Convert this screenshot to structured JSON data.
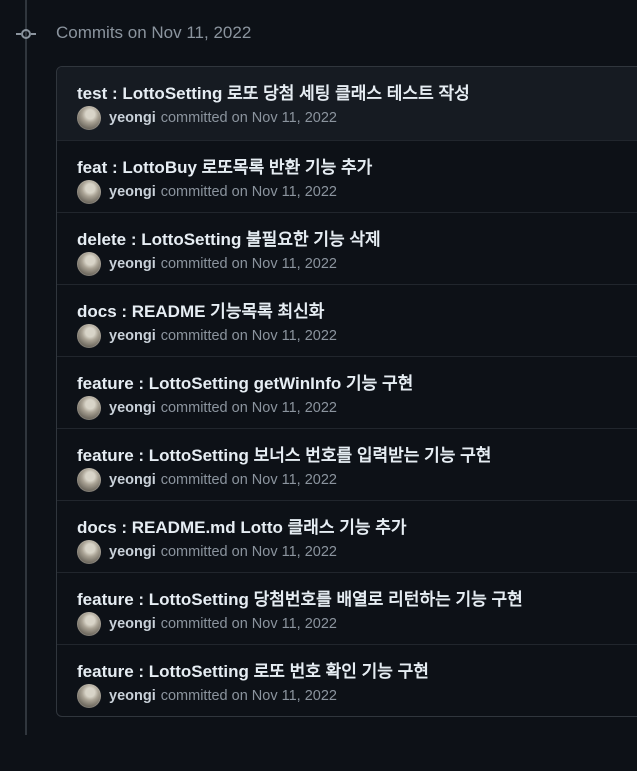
{
  "group": {
    "title": "Commits on Nov 11, 2022"
  },
  "commits": [
    {
      "title": "test : LottoSetting 로또 당첨 세팅 클래스 테스트 작성",
      "author": "yeongi",
      "action": "committed on",
      "date": "Nov 11, 2022"
    },
    {
      "title": "feat : LottoBuy 로또목록 반환 기능 추가",
      "author": "yeongi",
      "action": "committed on",
      "date": "Nov 11, 2022"
    },
    {
      "title": "delete : LottoSetting 불필요한 기능 삭제",
      "author": "yeongi",
      "action": "committed on",
      "date": "Nov 11, 2022"
    },
    {
      "title": "docs : README 기능목록 최신화",
      "author": "yeongi",
      "action": "committed on",
      "date": "Nov 11, 2022"
    },
    {
      "title": "feature : LottoSetting getWinInfo 기능 구현",
      "author": "yeongi",
      "action": "committed on",
      "date": "Nov 11, 2022"
    },
    {
      "title": "feature : LottoSetting 보너스 번호를 입력받는 기능 구현",
      "author": "yeongi",
      "action": "committed on",
      "date": "Nov 11, 2022"
    },
    {
      "title": "docs : README.md Lotto 클래스 기능 추가",
      "author": "yeongi",
      "action": "committed on",
      "date": "Nov 11, 2022"
    },
    {
      "title": "feature : LottoSetting 당첨번호를 배열로 리턴하는 기능 구현",
      "author": "yeongi",
      "action": "committed on",
      "date": "Nov 11, 2022"
    },
    {
      "title": "feature : LottoSetting 로또 번호 확인 기능 구현",
      "author": "yeongi",
      "action": "committed on",
      "date": "Nov 11, 2022"
    }
  ],
  "icons": {
    "group_node": "git-commit-icon",
    "avatar": "avatar"
  },
  "colors": {
    "background": "#0d1117",
    "border": "#30363d",
    "title_text": "#e6edf3",
    "muted_text": "#8b949e"
  }
}
